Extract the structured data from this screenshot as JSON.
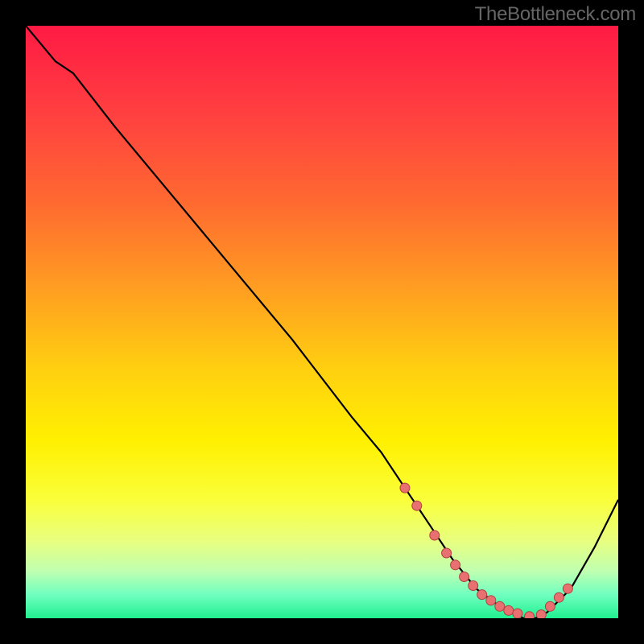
{
  "watermark": "TheBottleneck.com",
  "chart_data": {
    "type": "line",
    "title": "",
    "xlabel": "",
    "ylabel": "",
    "xlim": [
      0,
      100
    ],
    "ylim": [
      0,
      100
    ],
    "grid": false,
    "curve": {
      "x": [
        0,
        5,
        8,
        15,
        25,
        35,
        45,
        55,
        60,
        64,
        68,
        72,
        76,
        80,
        82,
        84,
        86,
        88,
        92,
        96,
        100
      ],
      "y": [
        100,
        94,
        92,
        83,
        71,
        59,
        47,
        34,
        28,
        22,
        16,
        10,
        5,
        2,
        1,
        0,
        0,
        1,
        5,
        12,
        20
      ]
    },
    "markers": {
      "x": [
        64,
        66,
        69,
        71,
        72.5,
        74,
        75.5,
        77,
        78.5,
        80,
        81.5,
        83,
        85,
        87,
        88.5,
        90,
        91.5
      ],
      "y": [
        22,
        19,
        14,
        11,
        9,
        7,
        5.5,
        4,
        3,
        2,
        1.3,
        0.8,
        0.3,
        0.6,
        2,
        3.5,
        5
      ]
    },
    "background_gradient": {
      "stops": [
        {
          "offset": 0.0,
          "color": "#ff1a44"
        },
        {
          "offset": 0.15,
          "color": "#ff4040"
        },
        {
          "offset": 0.3,
          "color": "#ff6a30"
        },
        {
          "offset": 0.45,
          "color": "#ffa020"
        },
        {
          "offset": 0.58,
          "color": "#ffd010"
        },
        {
          "offset": 0.7,
          "color": "#fff000"
        },
        {
          "offset": 0.8,
          "color": "#faff3a"
        },
        {
          "offset": 0.87,
          "color": "#e8ff80"
        },
        {
          "offset": 0.92,
          "color": "#c0ffb0"
        },
        {
          "offset": 0.96,
          "color": "#70ffc0"
        },
        {
          "offset": 1.0,
          "color": "#20f090"
        }
      ]
    },
    "marker_style": {
      "fill": "#e97070",
      "stroke": "#b04040",
      "r": 6
    }
  }
}
